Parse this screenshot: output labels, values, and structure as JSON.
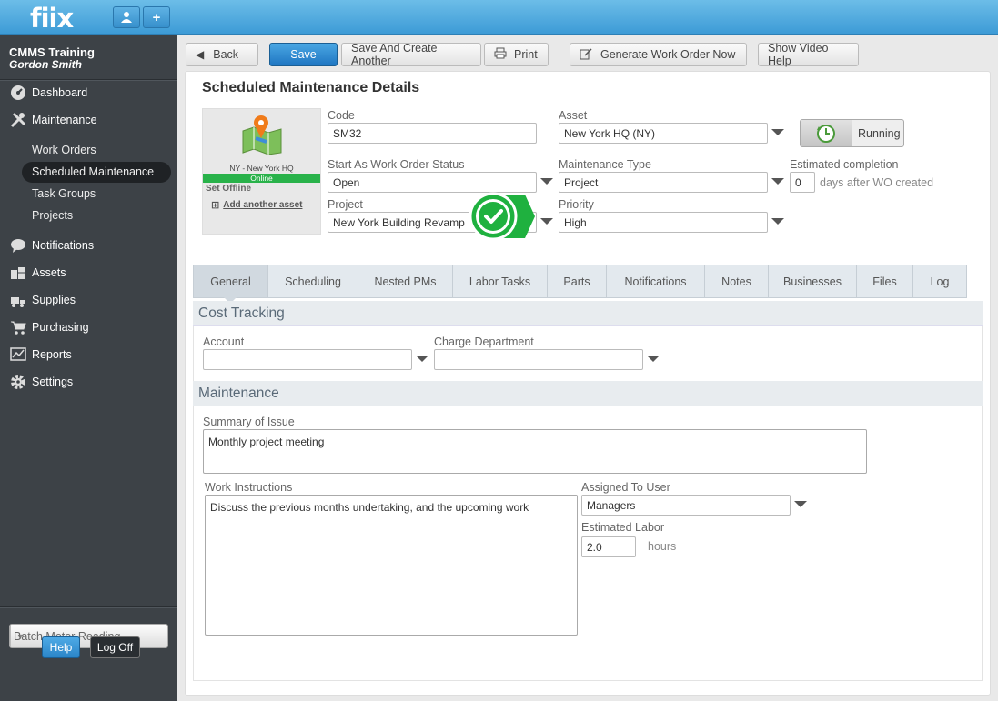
{
  "app": {
    "logo": "fiix"
  },
  "sidebar": {
    "company": "CMMS Training",
    "user": "Gordon Smith",
    "nav": {
      "dashboard": "Dashboard",
      "maintenance": "Maintenance",
      "work_orders": "Work Orders",
      "scheduled_maintenance": "Scheduled Maintenance",
      "task_groups": "Task Groups",
      "projects": "Projects",
      "notifications": "Notifications",
      "assets": "Assets",
      "supplies": "Supplies",
      "purchasing": "Purchasing",
      "reports": "Reports",
      "settings": "Settings"
    },
    "batch_meter_reading": "Batch Meter Reading",
    "help": "Help",
    "log_off": "Log Off"
  },
  "toolbar": {
    "back": "Back",
    "save": "Save",
    "save_and_create": "Save And Create Another",
    "print": "Print",
    "generate_wo": "Generate Work Order Now",
    "show_video_help": "Show Video Help"
  },
  "page": {
    "title": "Scheduled Maintenance Details"
  },
  "asset_card": {
    "name": "NY - New York HQ",
    "status": "Online",
    "set_offline": "Set Offline",
    "add_another_asset": "Add another asset"
  },
  "form": {
    "code_label": "Code",
    "code_value": "SM32",
    "asset_label": "Asset",
    "asset_value": "New York HQ (NY)",
    "running": "Running",
    "status_label": "Start As Work Order Status",
    "status_value": "Open",
    "mtype_label": "Maintenance Type",
    "mtype_value": "Project",
    "est_label": "Estimated completion",
    "est_value": "0",
    "est_suffix": "days after WO created",
    "project_label": "Project",
    "project_value": "New York Building Revamp",
    "priority_label": "Priority",
    "priority_value": "High"
  },
  "tabs": [
    "General",
    "Scheduling",
    "Nested PMs",
    "Labor Tasks",
    "Parts",
    "Notifications",
    "Notes",
    "Businesses",
    "Files",
    "Log"
  ],
  "cost": {
    "title": "Cost Tracking",
    "account_label": "Account",
    "account_value": "",
    "charge_label": "Charge Department",
    "charge_value": ""
  },
  "maint": {
    "title": "Maintenance",
    "summary_label": "Summary of Issue",
    "summary_value": "Monthly project meeting",
    "instructions_label": "Work Instructions",
    "instructions_value": "Discuss the previous months undertaking, and the upcoming work",
    "assigned_label": "Assigned To User",
    "assigned_value": "Managers",
    "labor_label": "Estimated Labor",
    "labor_value": "2.0",
    "labor_unit": "hours"
  },
  "colors": {
    "accent": "#3d9bd6",
    "sidebar": "#3d4247",
    "online": "#29b24a",
    "check": "#1fb13f"
  }
}
